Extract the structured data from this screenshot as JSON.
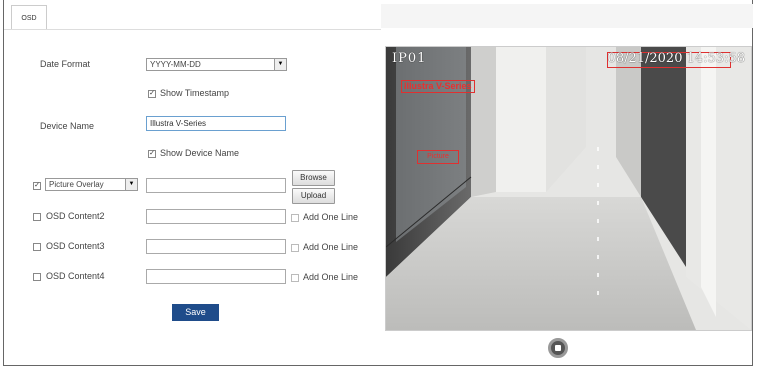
{
  "tab": {
    "label": "OSD"
  },
  "form": {
    "date_format_label": "Date Format",
    "date_format_value": "YYYY-MM-DD",
    "show_timestamp_label": "Show Timestamp",
    "show_timestamp_checked": true,
    "device_name_label": "Device Name",
    "device_name_value": "Illustra V-Series",
    "show_device_name_label": "Show Device Name",
    "show_device_name_checked": true,
    "overlay_select_value": "Picture Overlay",
    "overlay_checked": true,
    "browse_label": "Browse",
    "upload_label": "Upload",
    "osd_rows": [
      {
        "label": "OSD Content2",
        "value": "",
        "add_label": "Add One Line"
      },
      {
        "label": "OSD Content3",
        "value": "",
        "add_label": "Add One Line"
      },
      {
        "label": "OSD Content4",
        "value": "",
        "add_label": "Add One Line"
      }
    ],
    "save_label": "Save"
  },
  "preview": {
    "ip_label": "IP01",
    "timestamp": "08/21/2020 14:53:58",
    "device_overlay": "Illustra V-Series",
    "picture_overlay": "Picture"
  },
  "icons": {
    "stop": "stop-icon",
    "dropdown": "chevron-down-icon"
  }
}
